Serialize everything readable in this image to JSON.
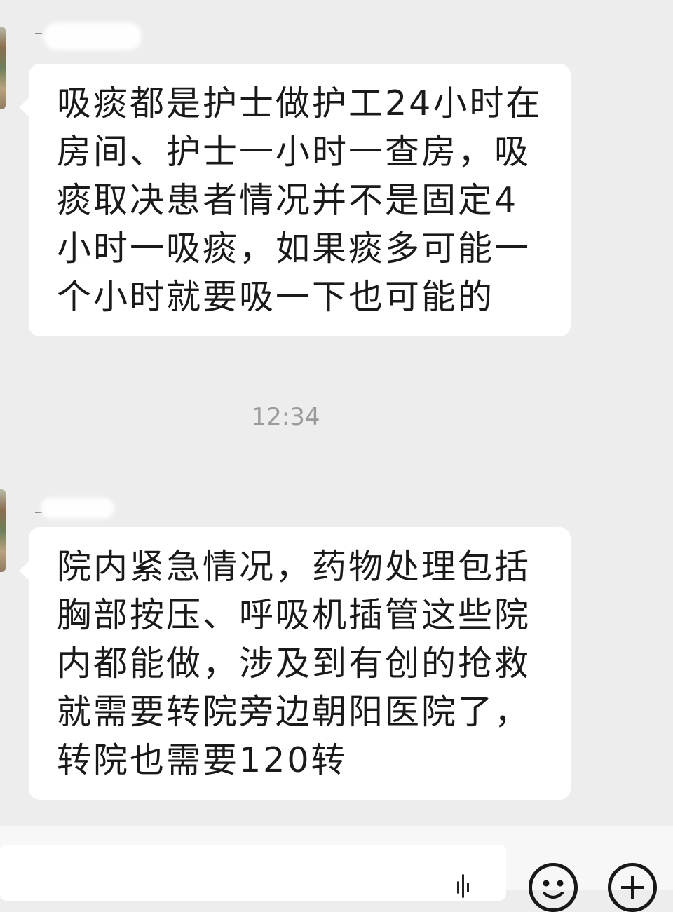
{
  "chat": {
    "messages": [
      {
        "sender": "contact",
        "text": "吸痰都是护士做护工24小时在房间、护士一小时一查房，吸痰取决患者情况并不是固定4小时一吸痰，如果痰多可能一个小时就要吸一下也可能的"
      },
      {
        "sender": "contact",
        "text": "院内紧急情况，药物处理包括胸部按压、呼吸机插管这些院内都能做，涉及到有创的抢救就需要转院旁边朝阳医院了，转院也需要120转"
      }
    ],
    "timestamp": "12:34"
  },
  "input_bar": {
    "text_value": "",
    "voice_icon": "voice-wave-icon",
    "emoji_icon": "emoji-icon",
    "plus_icon": "plus-icon"
  },
  "colors": {
    "background": "#ededed",
    "bubble": "#ffffff",
    "text": "#1a1a1a",
    "timestamp": "#9a9a9a"
  }
}
